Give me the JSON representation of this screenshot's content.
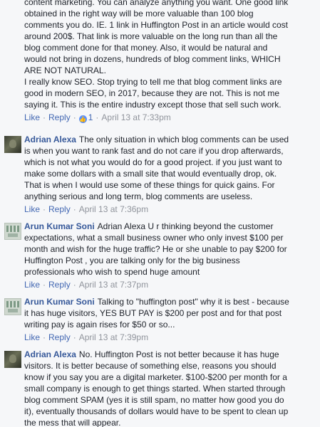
{
  "actions": {
    "like": "Like",
    "reply": "Reply",
    "separator": "·"
  },
  "comments": [
    {
      "author": "",
      "lines": [
        "content marketing. You can analyze anything you want. One good link",
        "obtained in the right way will be more valuable than 100 blog",
        "comments you do. IE. 1 link in Huffington Post in an article would cost",
        "around 200$. That link is more valuable on the long run than all the",
        "blog comment done for that money. Also, it would be natural and",
        "would not bring in dozens, hundreds of blog comment links, WHICH",
        "ARE NOT NATURAL.",
        "I really know SEO. Stop trying to tell me that blog comment links are",
        "good in modern SEO, in 2017, because they are not. This is not me",
        "saying it. This is the entire industry except those that sell such work."
      ],
      "reactions": "1",
      "time": "April 13 at 7:33pm"
    },
    {
      "author": "Adrian Alexa",
      "lines": [
        "The only situation in which blog comments can be used",
        "is when you want to rank fast and do not care if you drop afterwards,",
        "which is not what you would do for a good project. if you just want to",
        "make some dollars with a small site that would eventually drop, ok.",
        "That is when I would use some of these things for quick gains. For",
        "anything serious and long term, blog comments are useless."
      ],
      "time": "April 13 at 7:36pm"
    },
    {
      "author": "Arun Kumar Soni",
      "lines": [
        "Adrian Alexa U r thinking beyond the customer",
        "expectations, what a small business owner who only invest $100 per",
        "month and wish for the huge traffic? He or she unable to pay $200 for",
        "Huffington Post , you are talking only for the big business",
        "professionals who wish to spend huge amount"
      ],
      "time": "April 13 at 7:37pm"
    },
    {
      "author": "Arun Kumar Soni",
      "lines": [
        "Talking to \"huffington post\" why it is best - because",
        "it has huge visitors, YES BUT PAY is $200 per post and for that post",
        "writing pay is again rises for $50 or so..."
      ],
      "time": "April 13 at 7:39pm"
    },
    {
      "author": "Adrian Alexa",
      "lines": [
        "No. Huffington Post is not better because it has huge",
        "visitors. It is better because of something else, reasons you should",
        "know if you say you are a digital marketer. $100-$200 per month for a",
        "small company is enough to get things started. When started through",
        "blog comment SPAM (yes it is still spam, no matter how good you do",
        "it), eventually thousands of dollars would have to be spent to clean up",
        "the mess that will appear."
      ]
    }
  ]
}
